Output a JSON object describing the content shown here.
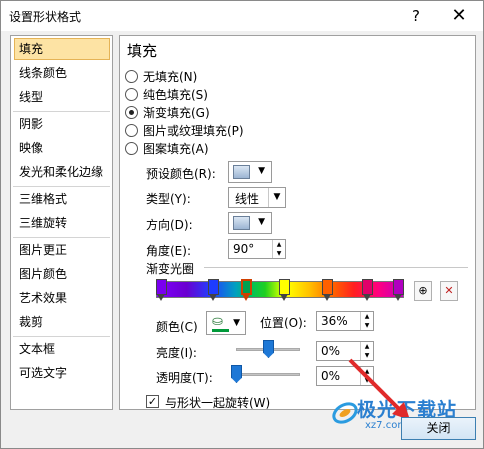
{
  "window": {
    "title": "设置形状格式",
    "help_glyph": "?",
    "close_glyph": "✕"
  },
  "sidebar": {
    "items": [
      {
        "label": "填充"
      },
      {
        "label": "线条颜色"
      },
      {
        "label": "线型"
      },
      {
        "label": "阴影"
      },
      {
        "label": "映像"
      },
      {
        "label": "发光和柔化边缘"
      },
      {
        "label": "三维格式"
      },
      {
        "label": "三维旋转"
      },
      {
        "label": "图片更正"
      },
      {
        "label": "图片颜色"
      },
      {
        "label": "艺术效果"
      },
      {
        "label": "裁剪"
      },
      {
        "label": "文本框"
      },
      {
        "label": "可选文字"
      }
    ],
    "selected": "填充"
  },
  "fill": {
    "title": "填充",
    "options": [
      {
        "label": "无填充(N)"
      },
      {
        "label": "纯色填充(S)"
      },
      {
        "label": "渐变填充(G)"
      },
      {
        "label": "图片或纹理填充(P)"
      },
      {
        "label": "图案填充(A)"
      }
    ],
    "selected_option": "渐变填充(G)",
    "preset_label": "预设颜色(R):",
    "type_label": "类型(Y):",
    "type_value": "线性",
    "direction_label": "方向(D):",
    "angle_label": "角度(E):",
    "angle_value": "90°",
    "stops_label": "渐变光圈",
    "add_stop_icon": "add-gradient-stop-icon",
    "remove_stop_icon": "remove-gradient-stop-icon",
    "color_label": "颜色(C)",
    "position_label": "位置(O):",
    "position_value": "36%",
    "brightness_label": "亮度(I):",
    "brightness_value": "0%",
    "brightness_level": 0.5,
    "transparency_label": "透明度(T):",
    "transparency_value": "0%",
    "transparency_level": 0.0,
    "rotate_label": "与形状一起旋转(W)",
    "rotate_checked": true,
    "arrow_glyph": "▼",
    "spin_up": "▲",
    "spin_down": "▼",
    "check_glyph": "✓",
    "bucket_glyph": "⛀"
  },
  "gradient_stops": [
    {
      "position": 0.0,
      "color": "#7a00f0"
    },
    {
      "position": 0.22,
      "color": "#1e3cff"
    },
    {
      "position": 0.36,
      "color": "#00a050",
      "selected": true
    },
    {
      "position": 0.52,
      "color": "#ffff00"
    },
    {
      "position": 0.7,
      "color": "#ff6000"
    },
    {
      "position": 0.87,
      "color": "#e0006a"
    },
    {
      "position": 1.0,
      "color": "#b000c0"
    }
  ],
  "footer": {
    "close_label": "关闭"
  },
  "watermark": {
    "text": "极光下载站",
    "sub": "xz7.com"
  },
  "colors": {
    "accent": "#1e78d6",
    "selected_bg": "#fde3a4",
    "selected_border": "#e5b356"
  }
}
